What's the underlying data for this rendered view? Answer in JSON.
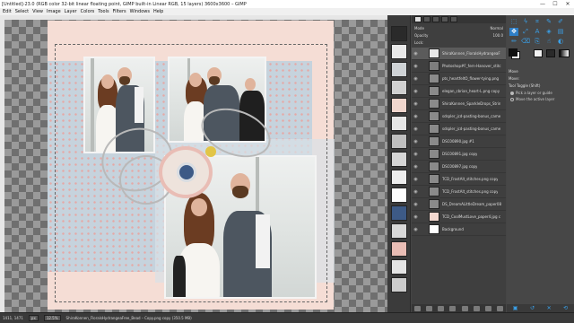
{
  "window": {
    "title": "[Untitled]-23.0 (RGB color 32-bit linear floating point, GIMP built-in Linear RGB, 15 layers) 3600x3600 – GIMP",
    "controls": [
      "—",
      "☐",
      "✕"
    ]
  },
  "menu": [
    "Edit",
    "Select",
    "View",
    "Image",
    "Layer",
    "Colors",
    "Tools",
    "Filters",
    "Windows",
    "Help"
  ],
  "layers_panel": {
    "header_label": "Mode",
    "header_value": "Normal",
    "opacity_label": "Opacity",
    "opacity_value": "100.0",
    "lock_label": "Lock:",
    "layers": [
      {
        "name": "ShiraKonnen_FloralsHydrangeaF",
        "visible": true,
        "selected": true
      },
      {
        "name": "Photoshop#F_fern-Hanover_stitc",
        "visible": true
      },
      {
        "name": "pts_heartfeltO_flower-tying.png",
        "visible": true
      },
      {
        "name": "elegan_cbrian_heart-L.png copy",
        "visible": true
      },
      {
        "name": "ShiraKonnen_SparkleDrops_Strin",
        "visible": true
      },
      {
        "name": "sdspler_jcd-pasting-bonus_came",
        "visible": true
      },
      {
        "name": "sdspler_jcd-pasting-bonus_came",
        "visible": true
      },
      {
        "name": "DSC00890.jpg #1",
        "visible": true
      },
      {
        "name": "DSC00891.jpg copy",
        "visible": true
      },
      {
        "name": "DSC00897.jpg copy",
        "visible": true
      },
      {
        "name": "TCD_FrostAlt_stitches.png copy",
        "visible": true
      },
      {
        "name": "TCD_FrostAlt_stitches.png copy",
        "visible": true
      },
      {
        "name": "DS_DreamALittleDream_paper08",
        "visible": true
      },
      {
        "name": "TCD_CoolMustLove_paper4.jpg c",
        "visible": true
      },
      {
        "name": "Background",
        "visible": true
      }
    ]
  },
  "tool_options": {
    "title": "Move",
    "mode_label": "Move:",
    "toggle_label": "Tool Toggle  (Shift)",
    "opt1": "Pick a layer or guide",
    "opt2": "Move the active layer"
  },
  "statusbar": {
    "coords": "1411, 1471",
    "unit": "px",
    "zoom": "12.5%",
    "message": "ShiraKonnen_FloralsHydrangeaFree_Bead – Copy.png copy (350.5 MB)"
  },
  "colors": {
    "accent": "#3aa0e8",
    "paper": "#f5ddd5",
    "panel": "#454545"
  }
}
